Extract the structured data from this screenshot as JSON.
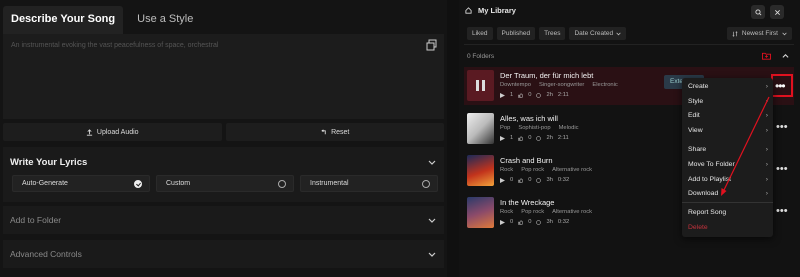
{
  "left": {
    "tabs": [
      "Describe Your Song",
      "Use a Style"
    ],
    "description_placeholder": "An instrumental evoking the vast peacefulness of space, orchestral",
    "upload_label": "Upload Audio",
    "reset_label": "Reset",
    "lyrics_title": "Write Your Lyrics",
    "lyrics_options": [
      "Auto-Generate",
      "Custom",
      "Instrumental"
    ],
    "add_to_folder": "Add to Folder",
    "advanced_controls": "Advanced Controls"
  },
  "library": {
    "title": "My Library",
    "filters": [
      "Liked",
      "Published",
      "Trees",
      "Date Created"
    ],
    "sort": "Newest First",
    "folders_label": "0 Folders",
    "songs": [
      {
        "title": "Der Traum, der für mich lebt",
        "tags": [
          "Downtempo",
          "Singer-songwriter",
          "Electronic"
        ],
        "plays": "1",
        "likes": "0",
        "duration1": "2h",
        "duration2": "2:11"
      },
      {
        "title": "Alles, was ich will",
        "tags": [
          "Pop",
          "Sophisti-pop",
          "Melodic"
        ],
        "plays": "1",
        "likes": "0",
        "duration1": "2h",
        "duration2": "2:11"
      },
      {
        "title": "Crash and Burn",
        "tags": [
          "Rock",
          "Pop rock",
          "Alternative rock"
        ],
        "plays": "0",
        "likes": "0",
        "duration1": "3h",
        "duration2": "0:32"
      },
      {
        "title": "In the Wreckage",
        "tags": [
          "Rock",
          "Pop rock",
          "Alternative rock"
        ],
        "plays": "0",
        "likes": "0",
        "duration1": "3h",
        "duration2": "0:32"
      }
    ],
    "extend_label": "Exte"
  },
  "menu": {
    "items": [
      "Create",
      "Style",
      "Edit",
      "View",
      "Share",
      "Move To Folder",
      "Add to Playlist",
      "Download",
      "Report Song",
      "Delete"
    ]
  },
  "colors": {
    "highlight": "#e0111f",
    "selected_row": "#2a1014",
    "danger": "#c4323c"
  }
}
